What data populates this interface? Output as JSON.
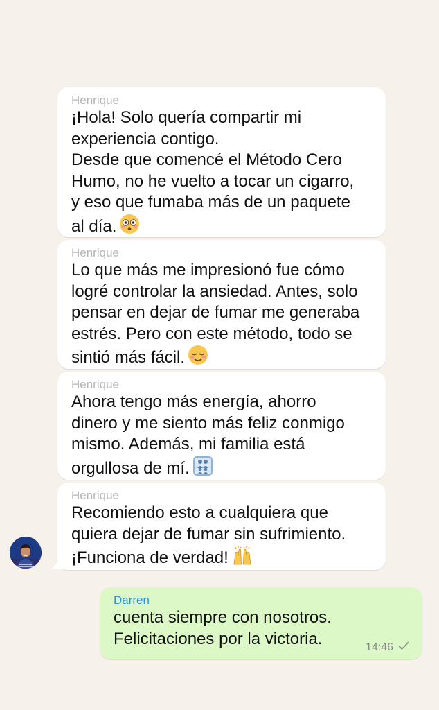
{
  "messages": [
    {
      "sender": "Henrique",
      "text": "¡Hola! Solo quería compartir mi\nexperiencia contigo.\nDesde que comencé el Método Cero\nHumo, no he vuelto a tocar un cigarro,\ny eso que fumaba más de un paquete\nal día.",
      "emoji": "flushed-face-emoji"
    },
    {
      "sender": "Henrique",
      "text": "Lo que más me impresionó fue cómo\nlogré controlar la ansiedad. Antes, solo\npensar en dejar de fumar me generaba\nestrés. Pero con este método, todo se\nsintió más fácil.",
      "emoji": "relieved-face-emoji"
    },
    {
      "sender": "Henrique",
      "text": "Ahora tengo más energía, ahorro\ndinero y me siento más feliz conmigo\nmismo. Además, mi familia está\norgullosa de mí.",
      "emoji": "family-emoji"
    },
    {
      "sender": "Henrique",
      "text": "Recomiendo esto a cualquiera que\nquiera dejar de fumar sin sufrimiento.\n¡Funciona de verdad!",
      "emoji": "raising-hands-emoji"
    }
  ],
  "reply": {
    "sender": "Darren",
    "text": "cuenta siempre con nosotros.\nFelicitaciones por la victoria.",
    "time": "14:46"
  },
  "colors": {
    "background": "#f6f1eb",
    "incoming_bubble": "#ffffff",
    "outgoing_bubble": "#dcf8c6",
    "incoming_sender": "#b5b5b5",
    "outgoing_sender": "#2f8fd8"
  }
}
